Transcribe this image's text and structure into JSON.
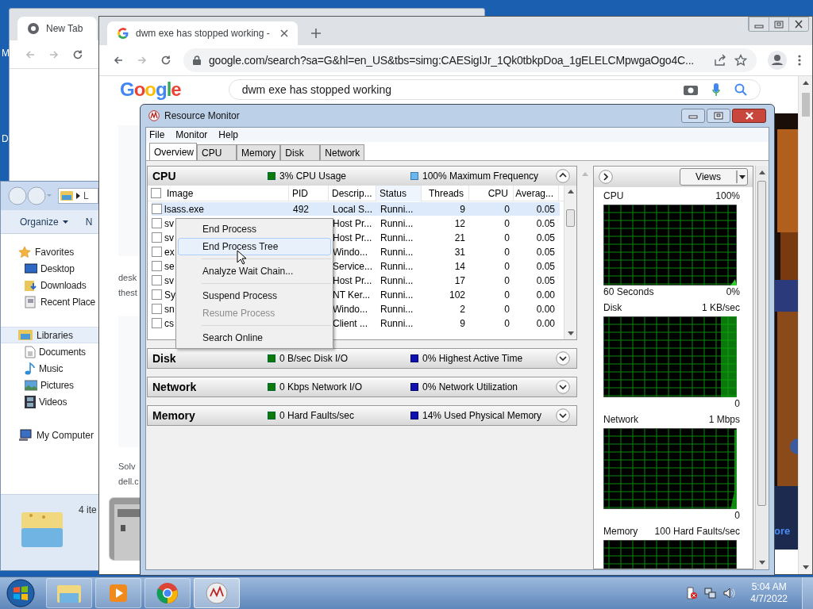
{
  "desktop_icons": [
    {
      "label": "M"
    },
    {
      "label": "D"
    }
  ],
  "chrome_back": {
    "tab": "New Tab"
  },
  "explorer": {
    "address": "L",
    "toolbar": [
      "Organize",
      "N"
    ],
    "nav": [
      {
        "label": "Favorites",
        "selected": false,
        "children": [
          {
            "label": "Desktop"
          },
          {
            "label": "Downloads"
          },
          {
            "label": "Recent Place"
          }
        ]
      },
      {
        "label": "Libraries",
        "selected": true,
        "children": [
          {
            "label": "Documents"
          },
          {
            "label": "Music"
          },
          {
            "label": "Pictures"
          },
          {
            "label": "Videos"
          }
        ]
      },
      {
        "label": "My Computer",
        "selected": false
      }
    ],
    "details": "4 ite"
  },
  "chrome": {
    "tab": "dwm exe has stopped working -",
    "url": "google.com/search?sa=G&hl=en_US&tbs=simg:CAESigIJr_1Qk0tbkpDoa_1gELELCMpwgaOgo4C...",
    "logo": "Google",
    "query": "dwm exe has stopped working",
    "snippets": [
      "desk",
      "thest",
      "Solv",
      "dell.c"
    ],
    "side_text": "ore"
  },
  "resource_monitor": {
    "title": "Resource Monitor",
    "menu": [
      "File",
      "Monitor",
      "Help"
    ],
    "tabs": [
      {
        "label": "Overview",
        "selected": true
      },
      {
        "label": "CPU",
        "selected": false
      },
      {
        "label": "Memory",
        "selected": false
      },
      {
        "label": "Disk",
        "selected": false
      },
      {
        "label": "Network",
        "selected": false
      }
    ],
    "sections": [
      {
        "name": "CPU",
        "expanded": true,
        "stat_1": "3% CPU Usage",
        "stat_2": "100% Maximum Frequency"
      },
      {
        "name": "Disk",
        "expanded": false,
        "stat_1": "0 B/sec Disk I/O",
        "stat_2": "0% Highest Active Time"
      },
      {
        "name": "Network",
        "expanded": false,
        "stat_1": "0 Kbps Network I/O",
        "stat_2": "0% Network Utilization"
      },
      {
        "name": "Memory",
        "expanded": false,
        "stat_1": "0 Hard Faults/sec",
        "stat_2": "14% Used Physical Memory"
      }
    ],
    "table": {
      "select_all_checked": false,
      "columns": [
        "Image",
        "PID",
        "Descrip...",
        "Status",
        "Threads",
        "CPU",
        "Averag..."
      ],
      "rows": [
        {
          "cells": [
            "lsass.exe",
            "492",
            "Local S...",
            "Runni...",
            "9",
            "0",
            "0.05"
          ],
          "selected": true,
          "checked": false
        },
        {
          "cells": [
            "sv",
            "",
            "Host Pr...",
            "Runni...",
            "12",
            "0",
            "0.05"
          ],
          "selected": false,
          "checked": false
        },
        {
          "cells": [
            "sv",
            "",
            "Host Pr...",
            "Runni...",
            "21",
            "0",
            "0.05"
          ],
          "selected": false,
          "checked": false
        },
        {
          "cells": [
            "ex",
            "",
            "Windo...",
            "Runni...",
            "31",
            "0",
            "0.05"
          ],
          "selected": false,
          "checked": false
        },
        {
          "cells": [
            "se",
            "",
            "Service...",
            "Runni...",
            "14",
            "0",
            "0.05"
          ],
          "selected": false,
          "checked": false
        },
        {
          "cells": [
            "sv",
            "",
            "Host Pr...",
            "Runni...",
            "17",
            "0",
            "0.05"
          ],
          "selected": false,
          "checked": false
        },
        {
          "cells": [
            "Sy",
            "",
            "NT Ker...",
            "Runni...",
            "102",
            "0",
            "0.00"
          ],
          "selected": false,
          "checked": false
        },
        {
          "cells": [
            "sn",
            "",
            "Windo...",
            "Runni...",
            "2",
            "0",
            "0.00"
          ],
          "selected": false,
          "checked": false
        },
        {
          "cells": [
            "cs",
            "",
            "Client ...",
            "Runni...",
            "9",
            "0",
            "0.00"
          ],
          "selected": false,
          "checked": false
        }
      ]
    },
    "context_menu": [
      {
        "label": "End Process",
        "selected": false,
        "disabled": false
      },
      {
        "label": "End Process Tree",
        "selected": true,
        "disabled": false
      },
      {
        "kind": "separator"
      },
      {
        "label": "Analyze Wait Chain...",
        "selected": false,
        "disabled": false
      },
      {
        "kind": "separator"
      },
      {
        "label": "Suspend Process",
        "selected": false,
        "disabled": false
      },
      {
        "label": "Resume Process",
        "selected": false,
        "disabled": true
      },
      {
        "kind": "separator"
      },
      {
        "label": "Search Online",
        "selected": false,
        "disabled": false
      }
    ],
    "views_button": "Views",
    "graphs": [
      {
        "title": "CPU",
        "max": "100%",
        "bottom_left": "60 Seconds",
        "min": "0%"
      },
      {
        "title": "Disk",
        "max": "1 KB/sec",
        "min": "0"
      },
      {
        "title": "Network",
        "max": "1 Mbps",
        "min": "0"
      },
      {
        "title": "Memory",
        "max": "100 Hard Faults/sec"
      }
    ]
  },
  "taskbar": {
    "time": "5:04 AM",
    "date": "4/7/2022"
  }
}
